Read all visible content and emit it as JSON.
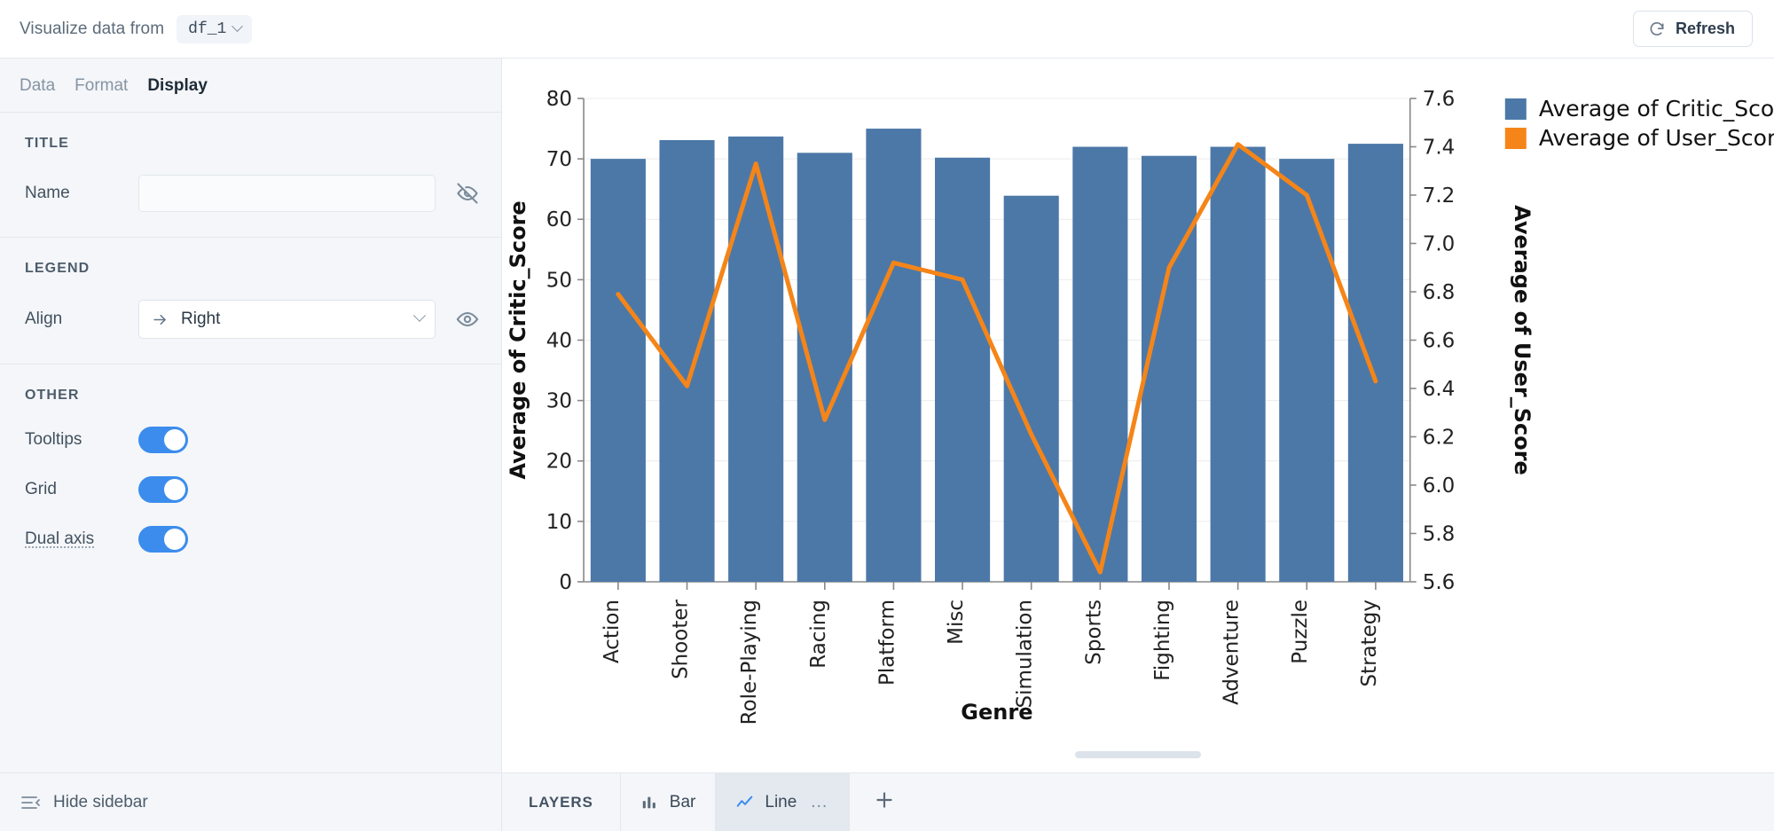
{
  "topbar": {
    "label": "Visualize data from",
    "dataframe": "df_1",
    "chevron_icon": "chevron-down-icon",
    "refresh_label": "Refresh",
    "refresh_icon": "refresh-icon"
  },
  "sidebar": {
    "tabs": [
      {
        "label": "Data",
        "active": false
      },
      {
        "label": "Format",
        "active": false
      },
      {
        "label": "Display",
        "active": true
      }
    ],
    "title_section": {
      "heading": "TITLE",
      "name_label": "Name",
      "name_value": "",
      "name_placeholder": "",
      "visibility_icon": "eye-off-icon"
    },
    "legend_section": {
      "heading": "LEGEND",
      "align_label": "Align",
      "align_value": "Right",
      "align_icon": "arrow-right-icon",
      "align_chevron": "chevron-down-icon",
      "visibility_icon": "eye-icon"
    },
    "other_section": {
      "heading": "OTHER",
      "toggles": [
        {
          "label": "Tooltips",
          "on": true,
          "hinted": false
        },
        {
          "label": "Grid",
          "on": true,
          "hinted": false
        },
        {
          "label": "Dual axis",
          "on": true,
          "hinted": true
        }
      ]
    },
    "footer": {
      "label": "Hide sidebar",
      "icon": "collapse-sidebar-icon"
    }
  },
  "layers_bar": {
    "title": "LAYERS",
    "layers": [
      {
        "label": "Bar",
        "icon": "bar-chart-icon",
        "active": false
      },
      {
        "label": "Line",
        "icon": "line-chart-icon",
        "active": true,
        "overflow": "…"
      }
    ],
    "add_icon": "plus-icon",
    "add_label": "+"
  },
  "chart_data": {
    "type": "bar",
    "title": "",
    "xlabel": "Genre",
    "ylabel": "Average of Critic_Score",
    "y2label": "Average of User_Score",
    "categories": [
      "Action",
      "Shooter",
      "Role-Playing",
      "Racing",
      "Platform",
      "Misc",
      "Simulation",
      "Sports",
      "Fighting",
      "Adventure",
      "Puzzle",
      "Strategy"
    ],
    "ylim": [
      0,
      80
    ],
    "yticks": [
      0,
      10,
      20,
      30,
      40,
      50,
      60,
      70,
      80
    ],
    "y2lim": [
      5.6,
      7.6
    ],
    "y2ticks": [
      5.6,
      5.8,
      6.0,
      6.2,
      6.4,
      6.6,
      6.8,
      7.0,
      7.2,
      7.4,
      7.6
    ],
    "grid": true,
    "legend_position": "right",
    "colors": {
      "bar": "#4c78a8",
      "line": "#f58518"
    },
    "series": [
      {
        "name": "Average of Critic_Score",
        "type": "bar",
        "axis": "left",
        "color": "#4c78a8",
        "values": [
          70.0,
          73.1,
          73.7,
          71.0,
          75.0,
          70.2,
          63.9,
          72.0,
          70.5,
          72.0,
          70.0,
          72.5
        ]
      },
      {
        "name": "Average of User_Score",
        "type": "line",
        "axis": "right",
        "color": "#f58518",
        "values": [
          6.79,
          6.41,
          7.33,
          6.27,
          6.92,
          6.85,
          6.21,
          5.64,
          6.9,
          7.41,
          7.2,
          6.43
        ]
      }
    ],
    "legend": [
      "Average of Critic_Score",
      "Average of User_Score"
    ]
  }
}
